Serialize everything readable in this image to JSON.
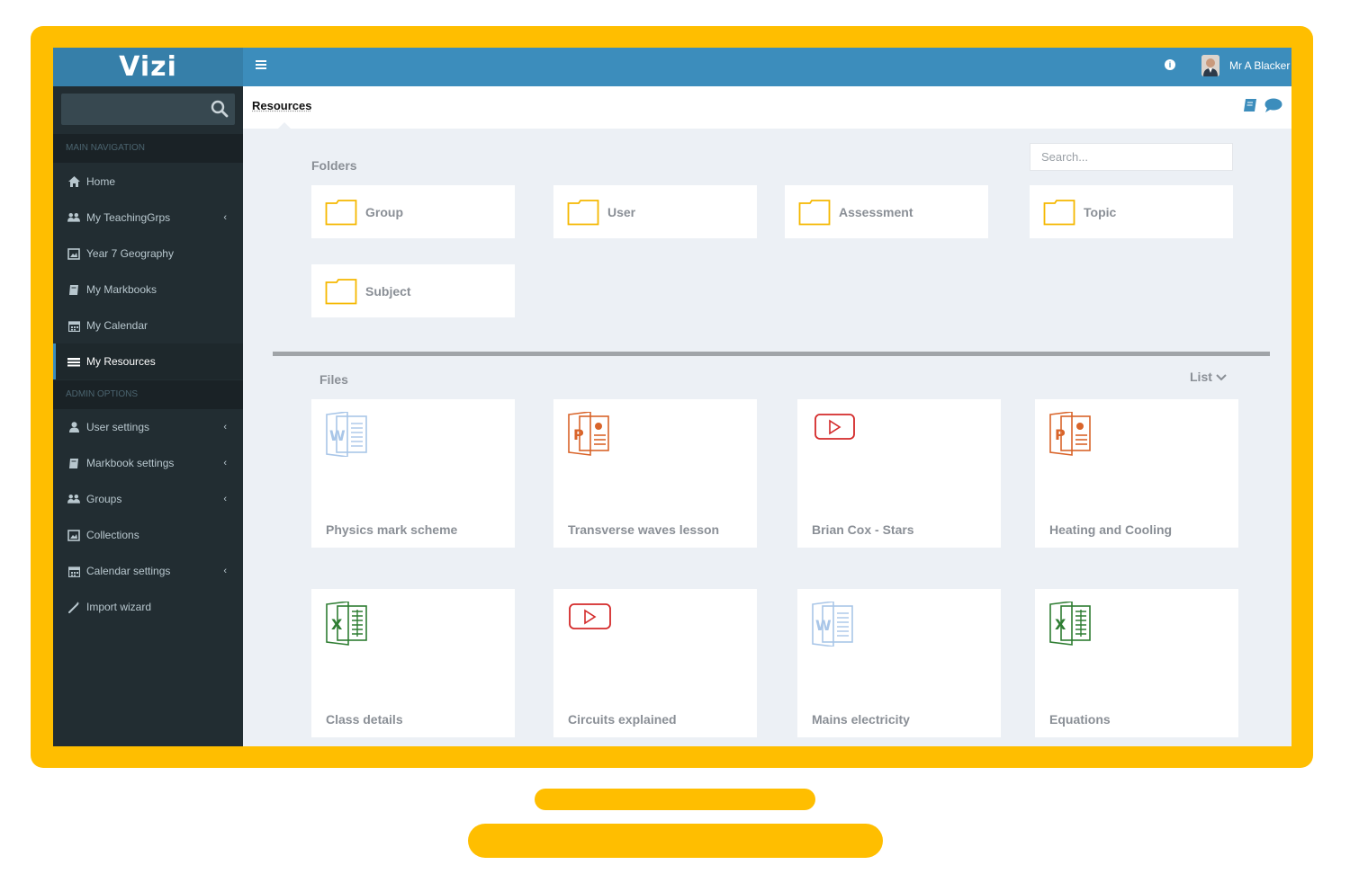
{
  "app": {
    "logo": "Vizi"
  },
  "sidebar": {
    "main_header": "MAIN NAVIGATION",
    "admin_header": "ADMIN OPTIONS",
    "items": [
      {
        "label": "Home",
        "icon": "home-icon"
      },
      {
        "label": "My TeachingGrps",
        "icon": "users-icon"
      },
      {
        "label": "Year 7 Geography",
        "icon": "image-icon"
      },
      {
        "label": "My Markbooks",
        "icon": "book-icon"
      },
      {
        "label": "My Calendar",
        "icon": "calendar-icon"
      },
      {
        "label": "My Resources",
        "icon": "resources-icon"
      }
    ],
    "admin_items": [
      {
        "label": "User settings",
        "icon": "user-icon"
      },
      {
        "label": "Markbook settings",
        "icon": "book-icon"
      },
      {
        "label": "Groups",
        "icon": "users-icon"
      },
      {
        "label": "Collections",
        "icon": "image-icon"
      },
      {
        "label": "Calendar settings",
        "icon": "calendar-icon"
      },
      {
        "label": "Import wizard",
        "icon": "wand-icon"
      }
    ]
  },
  "topbar": {
    "user_name": "Mr A Blacker",
    "info": "i"
  },
  "header": {
    "title": "Resources"
  },
  "folders": {
    "label": "Folders",
    "search_placeholder": "Search...",
    "items": [
      "Group",
      "User",
      "Assessment",
      "Topic",
      "Subject"
    ]
  },
  "files": {
    "label": "Files",
    "view_toggle": "List",
    "items": [
      {
        "name": "Physics mark scheme",
        "type": "word"
      },
      {
        "name": "Transverse waves lesson",
        "type": "powerpoint"
      },
      {
        "name": "Brian Cox - Stars",
        "type": "video"
      },
      {
        "name": "Heating and Cooling",
        "type": "powerpoint"
      },
      {
        "name": "Class details",
        "type": "excel"
      },
      {
        "name": "Circuits explained",
        "type": "video"
      },
      {
        "name": "Mains electricity",
        "type": "word"
      },
      {
        "name": "Equations",
        "type": "excel"
      }
    ]
  },
  "colors": {
    "frame": "#ffbe00",
    "topbar": "#3c8dbc",
    "sidebar": "#222d32",
    "folder": "#f5b800",
    "word": "#a9c6e8",
    "powerpoint": "#d9642a",
    "excel": "#2e7d32",
    "video": "#d42a2a"
  }
}
